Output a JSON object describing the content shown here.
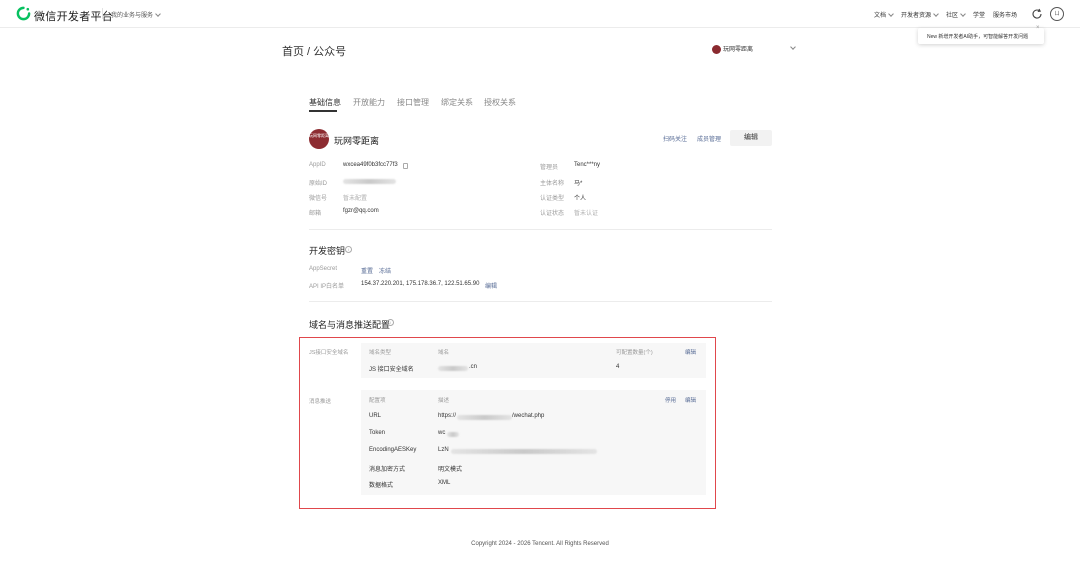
{
  "topbar": {
    "logo_text": "微信开发者平台",
    "biz_menu": "我的业务与服务",
    "nav": [
      "文档",
      "开发者资源",
      "社区",
      "学堂",
      "服务市场"
    ],
    "avatar_text": "ㄩ"
  },
  "popover": {
    "text": "New 新增开发者AI助手，可智能解答开发问题"
  },
  "header": {
    "breadcrumb": "首页 / 公众号",
    "account_switch": "玩网零距离"
  },
  "tabs": [
    "基础信息",
    "开放能力",
    "接口管理",
    "绑定关系",
    "授权关系"
  ],
  "profile": {
    "avatar_text": "玩网零距离",
    "name": "玩网零距离",
    "scan_follow": "扫码关注",
    "member_manage": "成员管理",
    "edit": "编辑"
  },
  "basic_info": {
    "appid_label": "AppID",
    "appid_value": "wxcea49f0b3fcc77f3",
    "original_id_label": "原始ID",
    "wechat_id_label": "微信号",
    "wechat_id_value": "暂未配置",
    "email_label": "邮箱",
    "email_value": "fgzr@qq.com",
    "admin_label": "管理员",
    "admin_value": "Tenc***ny",
    "subject_label": "主体名称",
    "subject_value": "马*",
    "cert_type_label": "认证类型",
    "cert_type_value": "个人",
    "cert_status_label": "认证状态",
    "cert_status_value": "暂未认证"
  },
  "dev_key": {
    "title": "开发密钥",
    "appsecret_label": "AppSecret",
    "reset": "重置",
    "freeze": "冻结",
    "whitelist_label": "API IP白名单",
    "whitelist_value": "154.37.220.201, 175.178.36.7, 122.51.65.90",
    "whitelist_edit": "编辑"
  },
  "domain_config": {
    "title": "域名与消息推送配置",
    "js_section_label": "JS接口安全域名",
    "js_headers": [
      "域名类型",
      "域名",
      "可配置数量(个)"
    ],
    "js_edit": "编辑",
    "js_row": {
      "type": "JS 接口安全域名",
      "domain_suffix": ".cn",
      "count": "4"
    },
    "push_section_label": "消息推送",
    "push_headers": [
      "配置项",
      "描述"
    ],
    "push_disable": "停用",
    "push_edit": "编辑",
    "push_rows": [
      {
        "key": "URL",
        "value_prefix": "https://",
        "value_suffix": "/wechat.php"
      },
      {
        "key": "Token",
        "value_prefix": "wc",
        "value_suffix": ""
      },
      {
        "key": "EncodingAESKey",
        "value_prefix": "LzN",
        "value_suffix": ""
      },
      {
        "key": "消息加密方式",
        "value_prefix": "明文模式",
        "value_suffix": ""
      },
      {
        "key": "数据格式",
        "value_prefix": "XML",
        "value_suffix": ""
      }
    ]
  },
  "footer": "Copyright 2024 - 2026 Tencent. All Rights Reserved"
}
